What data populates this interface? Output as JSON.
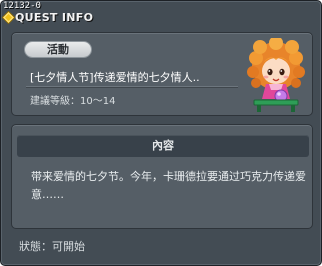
{
  "window": {
    "quest_id": "12132-0",
    "title": "QUEST INFO"
  },
  "quest": {
    "category": "活動",
    "name": "[七夕情人节]传递爱情的七夕情人..",
    "level_label": "建議等級：10～14"
  },
  "content": {
    "header": "內容",
    "description": "带来爱情的七夕节。今年，卡珊德拉要通过巧克力传递爱意……"
  },
  "footer": {
    "status": "狀態：可開始"
  },
  "icons": {
    "title_icon": "quest-diamond-icon",
    "npc": "npc-cassandra-portrait"
  },
  "colors": {
    "window_bg": "#434c54",
    "panel_bg": "#555e66",
    "header_bg": "#38414a",
    "title_accent": "#f2c21b"
  }
}
